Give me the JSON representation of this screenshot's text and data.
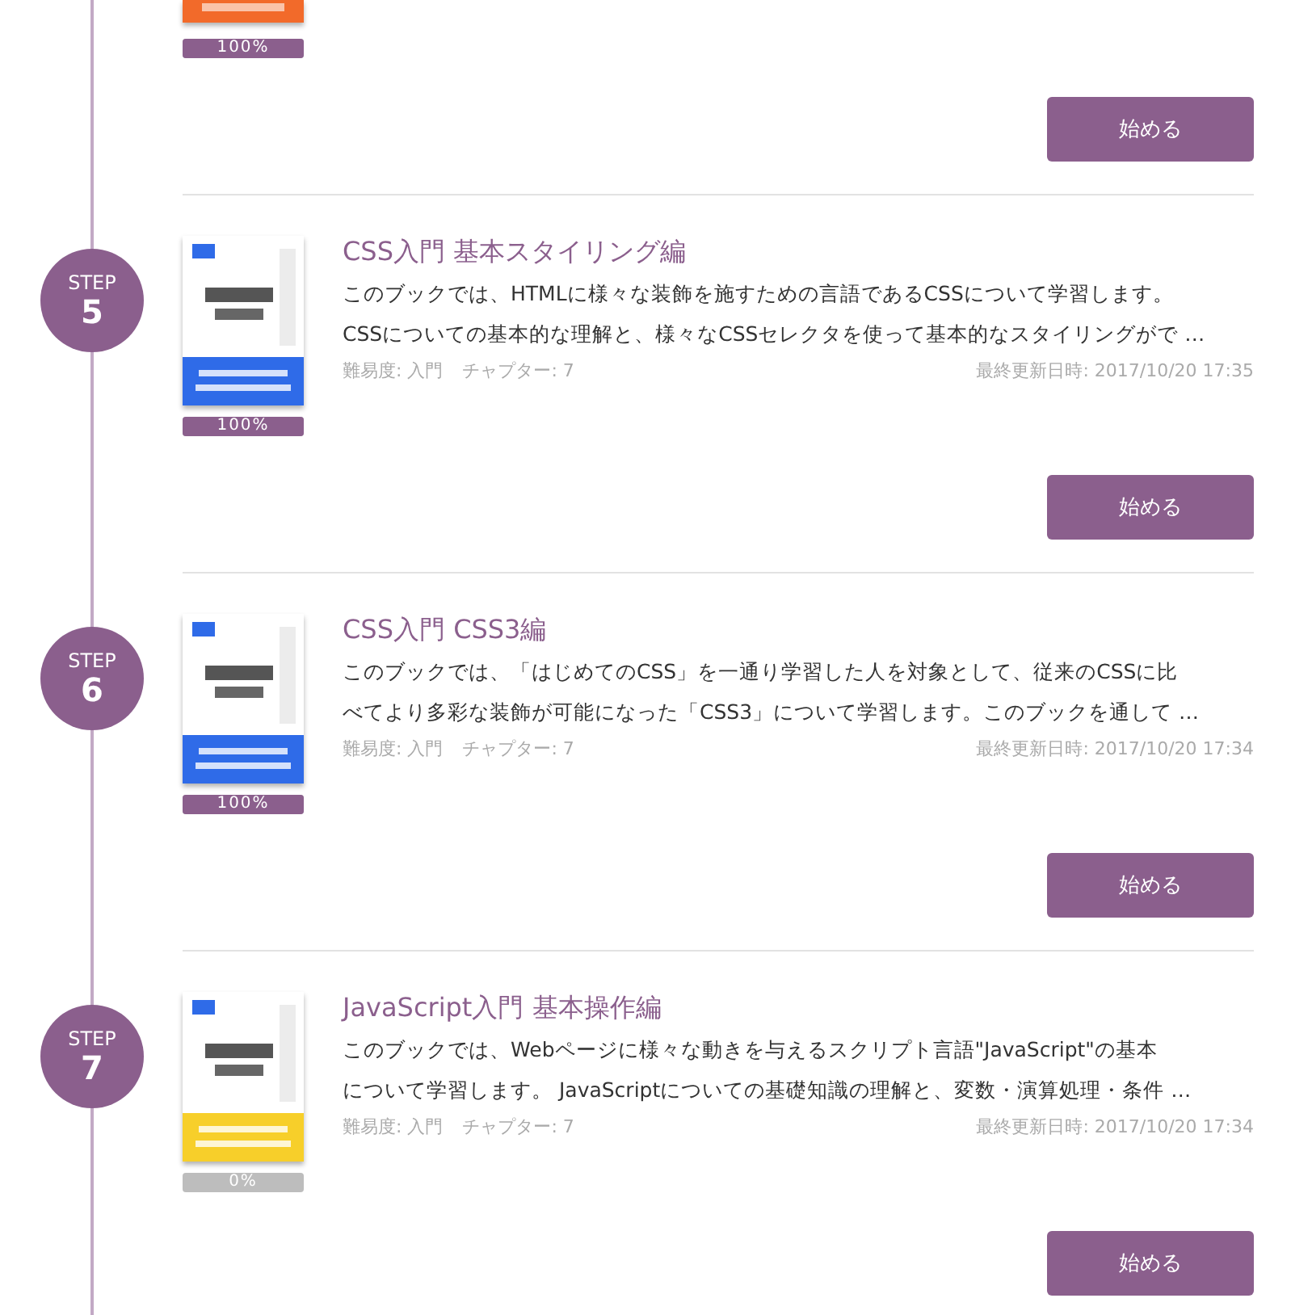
{
  "items": [
    {
      "kind": "partial",
      "progress": {
        "label": "100%",
        "level": 1
      },
      "button": "始める"
    },
    {
      "kind": "full",
      "step": {
        "label": "STEP",
        "number": "5"
      },
      "title": "CSS入門 基本スタイリング編",
      "description": [
        "このブックでは、HTMLに様々な装飾を施すための言語であるCSSについて学習します。",
        "CSSについての基本的な理解と、様々なCSSセレクタを使って基本的なスタイリングがで …"
      ],
      "difficulty": "難易度: 入門",
      "chapters": "チャプター: 7",
      "updated": "最終更新日時: 2017/10/20 17:35",
      "progress": {
        "label": "100%",
        "level": 1
      },
      "button": "始める"
    },
    {
      "kind": "full",
      "step": {
        "label": "STEP",
        "number": "6"
      },
      "title": "CSS入門 CSS3編",
      "description": [
        "このブックでは、「はじめてのCSS」を一通り学習した人を対象として、従来のCSSに比",
        "べてより多彩な装飾が可能になった「CSS3」について学習します。このブックを通して …"
      ],
      "difficulty": "難易度: 入門",
      "chapters": "チャプター: 7",
      "updated": "最終更新日時: 2017/10/20 17:34",
      "progress": {
        "label": "100%",
        "level": 1
      },
      "button": "始める"
    },
    {
      "kind": "full",
      "step": {
        "label": "STEP",
        "number": "7"
      },
      "title": "JavaScript入門 基本操作編",
      "description": [
        "このブックでは、Webページに様々な動きを与えるスクリプト言語\"JavaScript\"の基本",
        "について学習します。 JavaScriptについての基礎知識の理解と、変数・演算処理・条件 …"
      ],
      "difficulty": "難易度: 入門",
      "chapters": "チャプター: 7",
      "updated": "最終更新日時: 2017/10/20 17:34",
      "progress": {
        "label": "0%",
        "level": 0
      },
      "button": "始める"
    }
  ]
}
